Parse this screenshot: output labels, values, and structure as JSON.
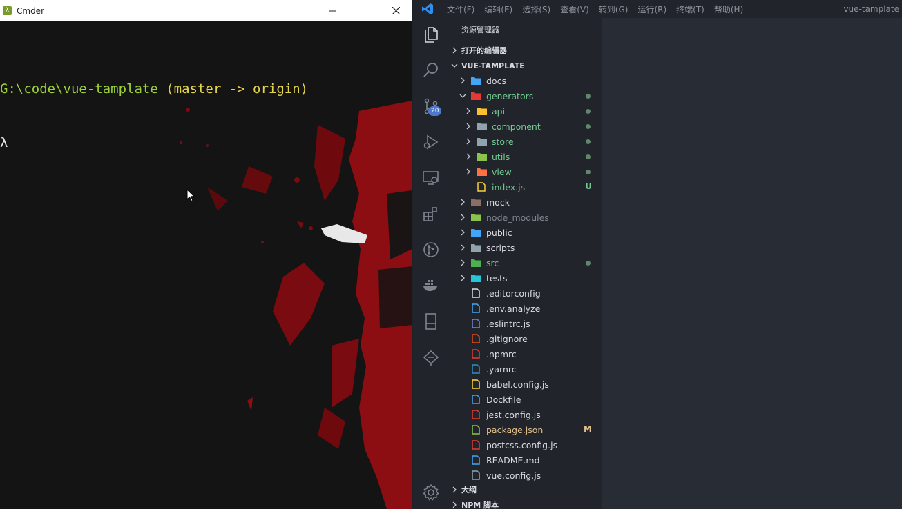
{
  "cmder": {
    "title": "Cmder",
    "path": "G:\\code\\vue-tamplate",
    "branch": " (master -> origin)",
    "prompt": "λ",
    "controls": [
      "minimize-icon",
      "maximize-icon",
      "close-icon"
    ]
  },
  "vscode": {
    "menus": [
      "文件(F)",
      "编辑(E)",
      "选择(S)",
      "查看(V)",
      "转到(G)",
      "运行(R)",
      "终端(T)",
      "帮助(H)"
    ],
    "window_title": "vue-tamplate",
    "activity": {
      "items": [
        "explorer-icon",
        "search-icon",
        "source-control-icon",
        "run-debug-icon",
        "remote-explorer-icon",
        "extensions-icon",
        "git-graph-icon",
        "docker-icon",
        "bookmarks-icon",
        "deploy-icon"
      ],
      "scm_badge": "20",
      "bottom": "settings-gear-icon"
    },
    "explorer": {
      "title": "资源管理器",
      "open_editors": "打开的编辑器",
      "project": "VUE-TAMPLATE",
      "outline": "大纲",
      "npm_scripts": "NPM 脚本",
      "tree": [
        {
          "label": "docs",
          "depth": 0,
          "folder": true,
          "expanded": false,
          "icon_color": "#42a5f5",
          "text": "default",
          "dot": false,
          "status": ""
        },
        {
          "label": "generators",
          "depth": 0,
          "folder": true,
          "expanded": true,
          "icon_color": "#e53935",
          "text": "green",
          "dot": true,
          "status": ""
        },
        {
          "label": "api",
          "depth": 1,
          "folder": true,
          "expanded": false,
          "icon_color": "#fbc02d",
          "text": "green",
          "dot": true,
          "status": ""
        },
        {
          "label": "component",
          "depth": 1,
          "folder": true,
          "expanded": false,
          "icon_color": "#90a4ae",
          "text": "green",
          "dot": true,
          "status": ""
        },
        {
          "label": "store",
          "depth": 1,
          "folder": true,
          "expanded": false,
          "icon_color": "#90a4ae",
          "text": "green",
          "dot": true,
          "status": ""
        },
        {
          "label": "utils",
          "depth": 1,
          "folder": true,
          "expanded": false,
          "icon_color": "#8bc34a",
          "text": "green",
          "dot": true,
          "status": ""
        },
        {
          "label": "view",
          "depth": 1,
          "folder": true,
          "expanded": false,
          "icon_color": "#ff7043",
          "text": "green",
          "dot": true,
          "status": ""
        },
        {
          "label": "index.js",
          "depth": 1,
          "folder": false,
          "expanded": false,
          "icon_color": "#f7d038",
          "text": "green",
          "dot": false,
          "status": "U"
        },
        {
          "label": "mock",
          "depth": 0,
          "folder": true,
          "expanded": false,
          "icon_color": "#8d6e63",
          "text": "default",
          "dot": false,
          "status": ""
        },
        {
          "label": "node_modules",
          "depth": 0,
          "folder": true,
          "expanded": false,
          "icon_color": "#8bc34a",
          "text": "dim",
          "dot": false,
          "status": ""
        },
        {
          "label": "public",
          "depth": 0,
          "folder": true,
          "expanded": false,
          "icon_color": "#42a5f5",
          "text": "default",
          "dot": false,
          "status": ""
        },
        {
          "label": "scripts",
          "depth": 0,
          "folder": true,
          "expanded": false,
          "icon_color": "#90a4ae",
          "text": "default",
          "dot": false,
          "status": ""
        },
        {
          "label": "src",
          "depth": 0,
          "folder": true,
          "expanded": false,
          "icon_color": "#4caf50",
          "text": "green",
          "dot": true,
          "status": ""
        },
        {
          "label": "tests",
          "depth": 0,
          "folder": true,
          "expanded": false,
          "icon_color": "#26c6da",
          "text": "default",
          "dot": false,
          "status": ""
        },
        {
          "label": ".editorconfig",
          "depth": 0,
          "folder": false,
          "expanded": false,
          "icon_color": "#e0e0e0",
          "text": "default",
          "dot": false,
          "status": ""
        },
        {
          "label": ".env.analyze",
          "depth": 0,
          "folder": false,
          "expanded": false,
          "icon_color": "#42a5f5",
          "text": "default",
          "dot": false,
          "status": ""
        },
        {
          "label": ".eslintrc.js",
          "depth": 0,
          "folder": false,
          "expanded": false,
          "icon_color": "#7986cb",
          "text": "default",
          "dot": false,
          "status": ""
        },
        {
          "label": ".gitignore",
          "depth": 0,
          "folder": false,
          "expanded": false,
          "icon_color": "#e64a19",
          "text": "default",
          "dot": false,
          "status": ""
        },
        {
          "label": ".npmrc",
          "depth": 0,
          "folder": false,
          "expanded": false,
          "icon_color": "#e53935",
          "text": "default",
          "dot": false,
          "status": ""
        },
        {
          "label": ".yarnrc",
          "depth": 0,
          "folder": false,
          "expanded": false,
          "icon_color": "#2c8ebb",
          "text": "default",
          "dot": false,
          "status": ""
        },
        {
          "label": "babel.config.js",
          "depth": 0,
          "folder": false,
          "expanded": false,
          "icon_color": "#fdd835",
          "text": "default",
          "dot": false,
          "status": ""
        },
        {
          "label": "Dockfile",
          "depth": 0,
          "folder": false,
          "expanded": false,
          "icon_color": "#42a5f5",
          "text": "default",
          "dot": false,
          "status": ""
        },
        {
          "label": "jest.config.js",
          "depth": 0,
          "folder": false,
          "expanded": false,
          "icon_color": "#e53935",
          "text": "default",
          "dot": false,
          "status": ""
        },
        {
          "label": "package.json",
          "depth": 0,
          "folder": false,
          "expanded": false,
          "icon_color": "#8bc34a",
          "text": "mod",
          "dot": false,
          "status": "M"
        },
        {
          "label": "postcss.config.js",
          "depth": 0,
          "folder": false,
          "expanded": false,
          "icon_color": "#e53935",
          "text": "default",
          "dot": false,
          "status": ""
        },
        {
          "label": "README.md",
          "depth": 0,
          "folder": false,
          "expanded": false,
          "icon_color": "#42a5f5",
          "text": "default",
          "dot": false,
          "status": ""
        },
        {
          "label": "vue.config.js",
          "depth": 0,
          "folder": false,
          "expanded": false,
          "icon_color": "#90a4ae",
          "text": "default",
          "dot": false,
          "status": ""
        }
      ]
    }
  }
}
